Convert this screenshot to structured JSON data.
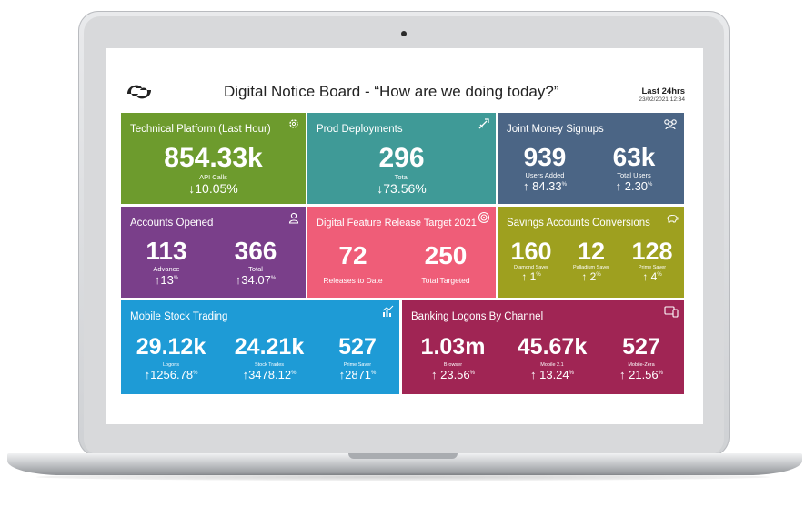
{
  "board": {
    "title": "Digital Notice Board - “How are we doing today?”",
    "period": "Last 24hrs",
    "date": "23/02/2021  12:34"
  },
  "tiles": {
    "platform": {
      "title": "Technical Platform (Last Hour)",
      "icon": "gear-icon",
      "color": "#6d9b2d",
      "value": "854.33k",
      "label": "API Calls",
      "arrow": "↓",
      "change": "10.05%"
    },
    "deployments": {
      "title": "Prod Deployments",
      "icon": "rocket-icon",
      "color": "#3f9a97",
      "value": "296",
      "label": "Total",
      "arrow": "↓",
      "change": "73.56%"
    },
    "joint": {
      "title": "Joint Money Signups",
      "icon": "users-icon",
      "color": "#4b6585",
      "metrics": [
        {
          "value": "939",
          "label": "Users Added",
          "arrow": "↑",
          "change": "84.33",
          "unit": "%"
        },
        {
          "value": "63k",
          "label": "Total Users",
          "arrow": "↑",
          "change": "2.30",
          "unit": "%"
        }
      ]
    },
    "accounts": {
      "title": "Accounts Opened",
      "icon": "user-icon",
      "color": "#7a3f8a",
      "metrics": [
        {
          "value": "113",
          "label": "Advance",
          "arrow": "↑",
          "change": "13",
          "unit": "%"
        },
        {
          "value": "366",
          "label": "Total",
          "arrow": "↑",
          "change": "34.07",
          "unit": "%"
        }
      ]
    },
    "releases": {
      "title": "Digital Feature Release Target 2021",
      "icon": "target-icon",
      "color": "#ef5d78",
      "metrics": [
        {
          "value": "72",
          "label": "Releases to Date"
        },
        {
          "value": "250",
          "label": "Total Targeted"
        }
      ]
    },
    "savings": {
      "title": "Savings Accounts Conversions",
      "icon": "piggy-bank-icon",
      "color": "#9ea01f",
      "metrics": [
        {
          "value": "160",
          "label": "Diamond Saver",
          "arrow": "↑",
          "change": "1",
          "unit": "%"
        },
        {
          "value": "12",
          "label": "Palladium Saver",
          "arrow": "↑",
          "change": "2",
          "unit": "%"
        },
        {
          "value": "128",
          "label": "Prime Saver",
          "arrow": "↑",
          "change": "4",
          "unit": "%"
        }
      ]
    },
    "stock": {
      "title": "Mobile Stock Trading",
      "icon": "chart-icon",
      "color": "#1e9bd6",
      "metrics": [
        {
          "value": "29.12k",
          "label": "Logons",
          "arrow": "↑",
          "change": "1256.78",
          "unit": "%"
        },
        {
          "value": "24.21k",
          "label": "Stock Trades",
          "arrow": "↑",
          "change": "3478.12",
          "unit": "%"
        },
        {
          "value": "527",
          "label": "Prime Saver",
          "arrow": "↑",
          "change": "2871",
          "unit": "%"
        }
      ]
    },
    "logons": {
      "title": "Banking Logons By Channel",
      "icon": "devices-icon",
      "color": "#a02554",
      "metrics": [
        {
          "value": "1.03m",
          "label": "Browser",
          "arrow": "↑",
          "change": "23.56",
          "unit": "%"
        },
        {
          "value": "45.67k",
          "label": "Mobile 2.1",
          "arrow": "↑",
          "change": "13.24",
          "unit": "%"
        },
        {
          "value": "527",
          "label": "Mobile-Zera",
          "arrow": "↑",
          "change": "21.56",
          "unit": "%"
        }
      ]
    }
  }
}
